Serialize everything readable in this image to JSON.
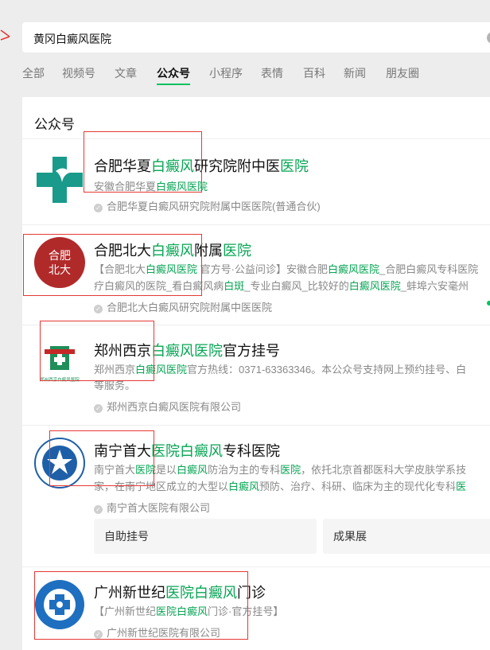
{
  "search": {
    "value": "黄冈白癜风医院",
    "clear_symbol": "✕"
  },
  "tabs": [
    "全部",
    "视频号",
    "文章",
    "公众号",
    "小程序",
    "表情",
    "百科",
    "新闻",
    "朋友圈"
  ],
  "active_tab": "公众号",
  "section_title": "公众号",
  "colors": {
    "highlight": "#07a554",
    "accent": "#07c160",
    "annotation": "#e53935"
  },
  "results": [
    {
      "name_parts": [
        "合肥华夏",
        "白癜风",
        "研究院附中医",
        "医院"
      ],
      "desc1_parts": [
        "安徽合肥华夏",
        "白癜风医院"
      ],
      "owner": "合肥华夏白癜风研究院附属中医医院(普通合伙)"
    },
    {
      "logo_text": "合肥北大",
      "name_parts": [
        "合肥北大",
        "白癜风",
        "附属",
        "医院"
      ],
      "desc1_parts": [
        "【合肥北大",
        "白癜风医院",
        " 官方号·公益问诊】安徽合肥",
        "白癜风医院",
        "_合肥白癜风专科医院"
      ],
      "desc2_parts": [
        "疗白癜风的医院_看白癜风病",
        "白斑",
        "_专业白癜风_比较好的",
        "白癜风医院",
        "_蚌埠六安毫州"
      ],
      "owner": "合肥北大白癜风研究院附属中医医院"
    },
    {
      "logo_text": "郑州西京白癜风医院",
      "name_parts": [
        "郑州西京",
        "白癜风医院",
        "官方挂号"
      ],
      "desc1_parts": [
        "郑州西京",
        "白癜风医院",
        "官方热线：0371-63363346。本公众号支持网上预约挂号、白"
      ],
      "desc2_parts": [
        "等服务。"
      ],
      "owner": "郑州西京白癜风医院有限公司"
    },
    {
      "name_parts": [
        "南宁首大",
        "医院白癜风",
        "专科医院"
      ],
      "desc1_parts": [
        "南宁首大",
        "医院",
        "是以",
        "白癜风",
        "防治为主的专科",
        "医院",
        "，依托北京首都医科大学皮肤学系技"
      ],
      "desc2_parts": [
        "家，在南宁地区成立的大型以",
        "白癜风",
        "预防、治疗、科研、临床为主的现代化专科",
        "医"
      ],
      "owner": "南宁首大医院有限公司",
      "actions": [
        "自助挂号",
        "成果展"
      ]
    },
    {
      "name_parts": [
        "广州新世纪",
        "医院白癜风",
        "门诊"
      ],
      "desc1_parts": [
        "【广州新世纪",
        "医院白癜风",
        "门诊·官方挂号】"
      ],
      "owner": "广州新世纪医院有限公司"
    }
  ]
}
